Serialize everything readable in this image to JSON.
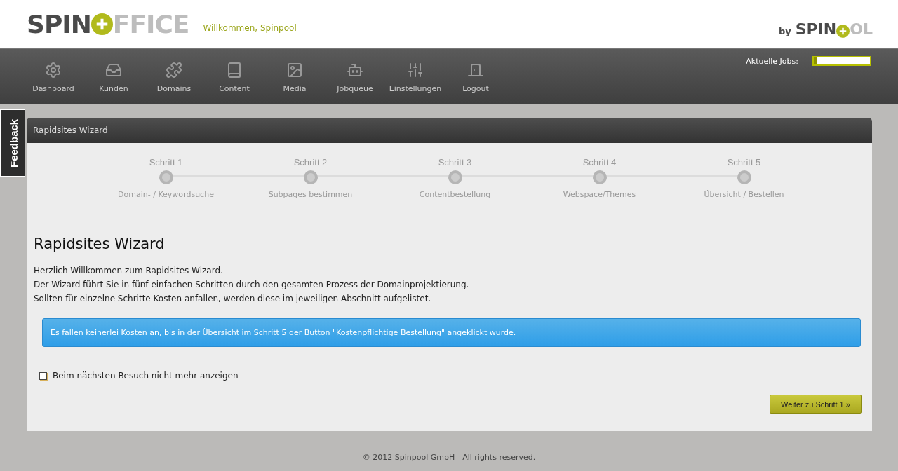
{
  "header": {
    "logo": {
      "left": "SPIN",
      "right": "FFICE"
    },
    "welcome": "Willkommen, Spinpool",
    "byline": {
      "by": "by",
      "left": "SPIN",
      "right": "OL"
    }
  },
  "nav": {
    "items": [
      {
        "label": "Dashboard",
        "kind": "gear"
      },
      {
        "label": "Kunden",
        "kind": "inbox"
      },
      {
        "label": "Domains",
        "kind": "puzzle"
      },
      {
        "label": "Content",
        "kind": "book"
      },
      {
        "label": "Media",
        "kind": "image"
      },
      {
        "label": "Jobqueue",
        "kind": "robot"
      },
      {
        "label": "Einstellungen",
        "kind": "sliders"
      },
      {
        "label": "Logout",
        "kind": "door"
      }
    ],
    "jobs": {
      "label": "Aktuelle Jobs:",
      "level": 0.05
    }
  },
  "feedback_tab": "Feedback",
  "panel": {
    "title": "Rapidsites Wizard",
    "steps": [
      {
        "title": "Schritt 1",
        "label": "Domain- / Keywordsuche"
      },
      {
        "title": "Schritt 2",
        "label": "Subpages bestimmen"
      },
      {
        "title": "Schritt 3",
        "label": "Contentbestellung"
      },
      {
        "title": "Schritt 4",
        "label": "Webspace/Themes"
      },
      {
        "title": "Schritt 5",
        "label": "Übersicht / Bestellen"
      }
    ],
    "heading": "Rapidsites Wizard",
    "intro": [
      "Herzlich Willkommen zum Rapidsites Wizard.",
      "Der Wizard führt Sie in fünf einfachen Schritten durch den gesamten Prozess der Domainprojektierung.",
      "Sollten für einzelne Schritte Kosten anfallen, werden diese im jeweiligen Abschnitt aufgelistet."
    ],
    "info": "Es fallen keinerlei Kosten an, bis in der Übersicht im Schritt 5 der Button \"Kostenpflichtige Bestellung\" angeklickt wurde.",
    "checkbox": {
      "label": "Beim nächsten Besuch nicht mehr anzeigen",
      "checked": false
    },
    "button": "Weiter zu Schritt 1 »"
  },
  "footer": "© 2012 Spinpool GmbH - All rights reserved."
}
